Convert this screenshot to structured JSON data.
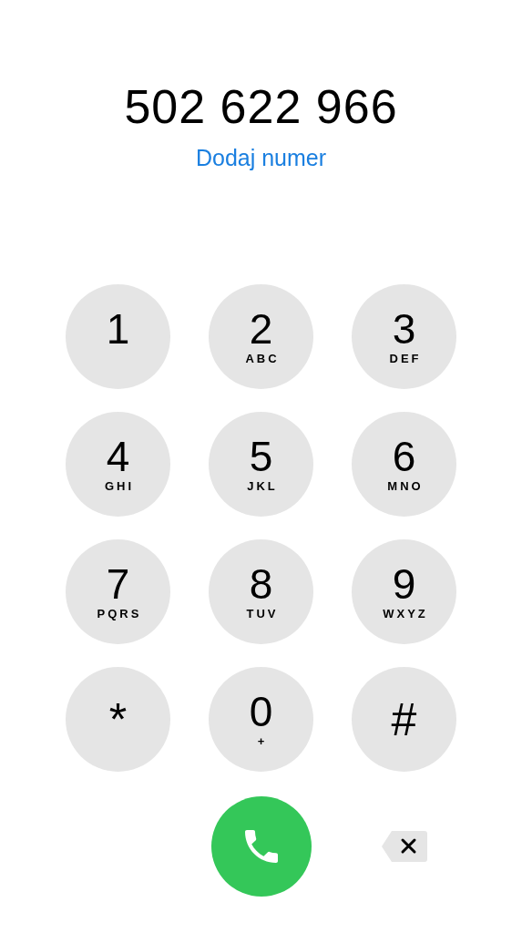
{
  "number": "502 622 966",
  "add_number_link": "Dodaj numer",
  "keys": [
    {
      "digit": "1"
    },
    {
      "digit": "2",
      "letters": "ABC"
    },
    {
      "digit": "3",
      "letters": "DEF"
    },
    {
      "digit": "4",
      "letters": "GHI"
    },
    {
      "digit": "5",
      "letters": "JKL"
    },
    {
      "digit": "6",
      "letters": "MNO"
    },
    {
      "digit": "7",
      "letters": "PQRS"
    },
    {
      "digit": "8",
      "letters": "TUV"
    },
    {
      "digit": "9",
      "letters": "WXYZ"
    },
    {
      "digit": "*"
    },
    {
      "digit": "0",
      "letters": "+"
    },
    {
      "digit": "#"
    }
  ]
}
